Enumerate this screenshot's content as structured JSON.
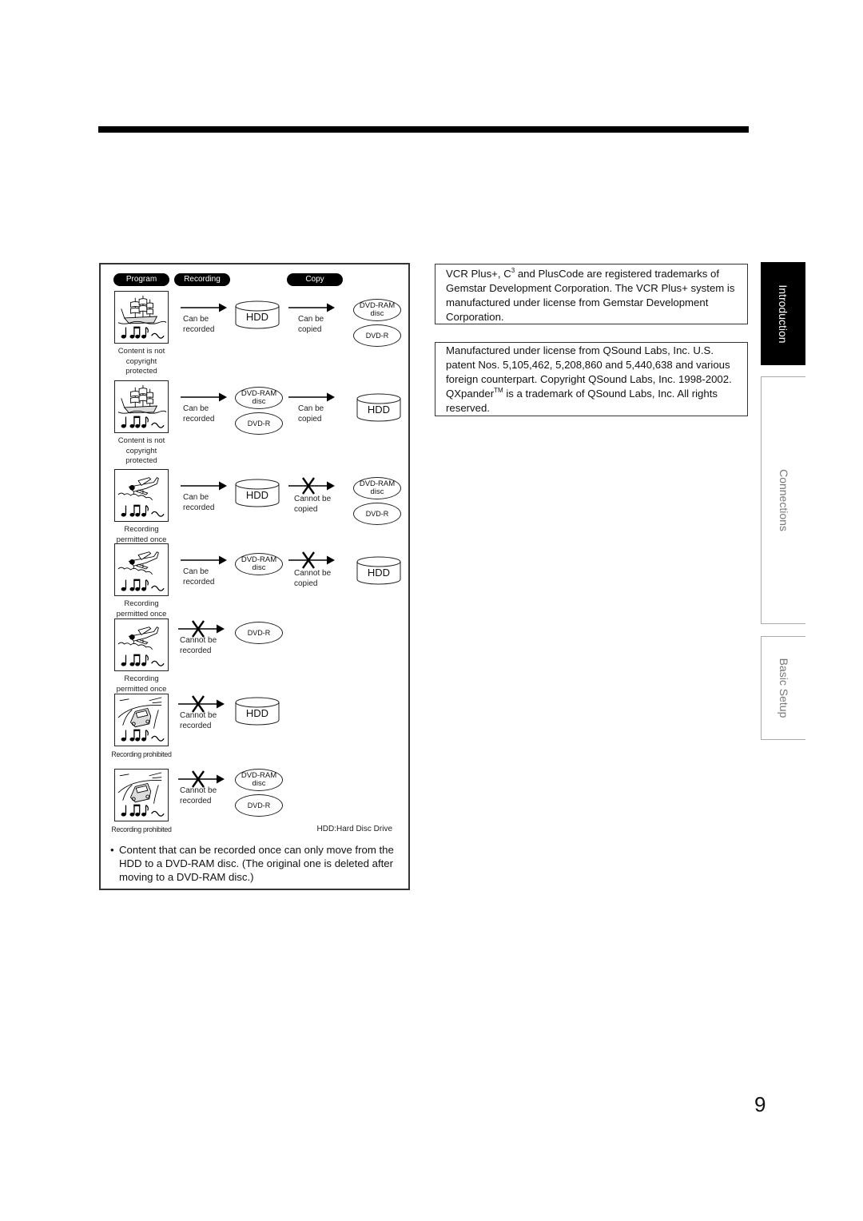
{
  "page_number": "9",
  "diagram": {
    "headers": {
      "program": "Program",
      "recording": "Recording",
      "copy": "Copy"
    },
    "legend": "HDD:Hard Disc Drive",
    "media": {
      "hdd": "HDD",
      "dvd_ram_line1": "DVD-RAM",
      "dvd_ram_line2": "disc",
      "dvd_r": "DVD-R"
    },
    "rows": [
      {
        "picture": "ship",
        "caption": [
          "Content is not",
          "copyright",
          "protected"
        ],
        "record": {
          "allowed": true,
          "line1": "Can be",
          "line2": "recorded",
          "target": "HDD"
        },
        "copy": {
          "allowed": true,
          "line1": "Can be",
          "line2": "copied",
          "target": "DVD-RAM disc / DVD-R"
        }
      },
      {
        "picture": "ship",
        "caption": [
          "Content is not",
          "copyright",
          "protected"
        ],
        "record": {
          "allowed": true,
          "line1": "Can be",
          "line2": "recorded",
          "target": "DVD-RAM disc / DVD-R"
        },
        "copy": {
          "allowed": true,
          "line1": "Can be",
          "line2": "copied",
          "target": "HDD"
        }
      },
      {
        "picture": "airplane",
        "caption": [
          "Recording",
          "permitted once"
        ],
        "record": {
          "allowed": true,
          "line1": "Can be",
          "line2": "recorded",
          "target": "HDD"
        },
        "copy": {
          "allowed": false,
          "line1": "Cannot be",
          "line2": "copied",
          "target": "DVD-RAM disc / DVD-R"
        }
      },
      {
        "picture": "airplane",
        "caption": [
          "Recording",
          "permitted once"
        ],
        "record": {
          "allowed": true,
          "line1": "Can be",
          "line2": "recorded",
          "target": "DVD-RAM disc"
        },
        "copy": {
          "allowed": false,
          "line1": "Cannot be",
          "line2": "copied",
          "target": "HDD"
        }
      },
      {
        "picture": "airplane",
        "caption": [
          "Recording",
          "permitted once"
        ],
        "record": {
          "allowed": false,
          "line1": "Cannot be",
          "line2": "recorded",
          "target": "DVD-R"
        }
      },
      {
        "picture": "car",
        "caption": [
          "Recording prohibited"
        ],
        "record": {
          "allowed": false,
          "line1": "Cannot be",
          "line2": "recorded",
          "target": "HDD"
        }
      },
      {
        "picture": "car",
        "caption": [
          "Recording prohibited"
        ],
        "record": {
          "allowed": false,
          "line1": "Cannot be",
          "line2": "recorded",
          "target": "DVD-RAM disc / DVD-R"
        }
      }
    ],
    "note_bullet": "•",
    "note": "Content that can be recorded once can only move from the HDD to a DVD-RAM disc. (The original one is deleted after moving to a DVD-RAM disc.)"
  },
  "trademark_box": {
    "line1_pre": "VCR Plus+, C",
    "line1_sup": "3",
    "line1_post": " and PlusCode are registered trademarks",
    "rest": "of Gemstar Development Corporation. The VCR Plus+ system is manufactured under license from Gemstar Development Corporation."
  },
  "qsound_box": {
    "text_pre": "Manufactured under license from QSound Labs, Inc. U.S. patent Nos. 5,105,462, 5,208,860 and 5,440,638 and various foreign counterpart. Copyright QSound Labs, Inc. 1998-2002. QXpander",
    "tm": "TM",
    "text_post": " is a trademark of QSound Labs, Inc. All rights reserved."
  },
  "side_tabs": [
    {
      "label": "Introduction",
      "active": true
    },
    {
      "label": "Connections",
      "active": false
    },
    {
      "label": "Basic Setup",
      "active": false
    }
  ]
}
